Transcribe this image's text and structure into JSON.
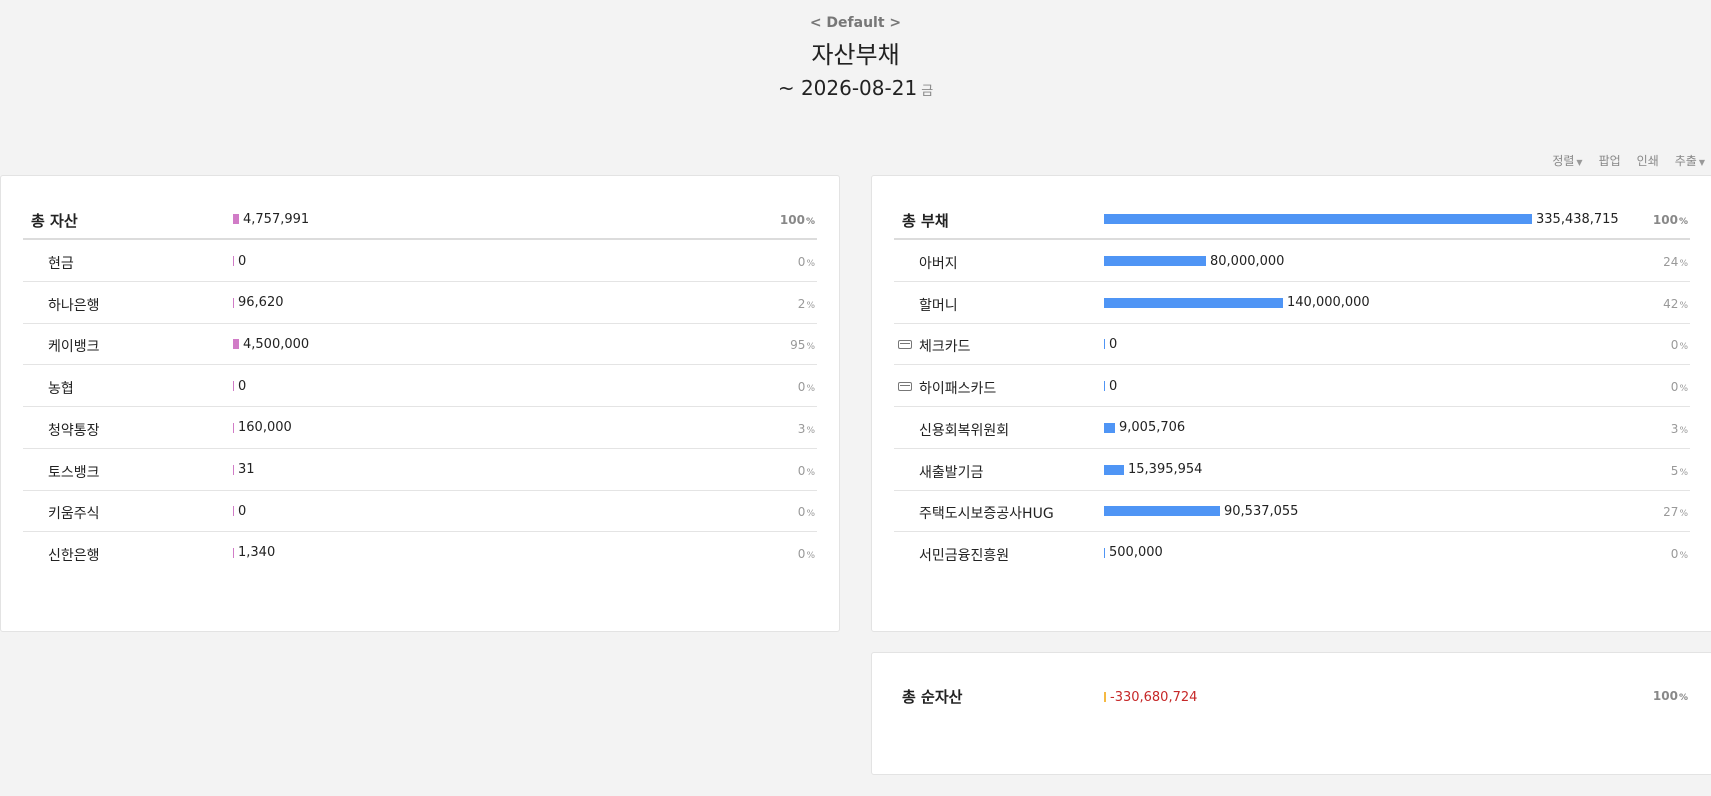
{
  "header": {
    "book": "< Default >",
    "title": "자산부채",
    "date": "~ 2026-08-21",
    "day_of_week": "금"
  },
  "toolbar": {
    "sort": "정렬",
    "popup": "팝업",
    "print": "인쇄",
    "export": "추출"
  },
  "colors": {
    "asset_bar": "#d17cc7",
    "liability_bar": "#4f95f5",
    "net_bar": "#f5b942",
    "negative_text": "#c62828"
  },
  "percent_sign": "%",
  "assets": {
    "total": {
      "label": "총 자산",
      "amount": "4,757,991",
      "percent": "100",
      "ratio": 0.0142
    },
    "items": [
      {
        "label": "현금",
        "amount": "0",
        "percent": "0",
        "ratio": 0
      },
      {
        "label": "하나은행",
        "amount": "96,620",
        "percent": "2",
        "ratio": 0.0003
      },
      {
        "label": "케이뱅크",
        "amount": "4,500,000",
        "percent": "95",
        "ratio": 0.0134
      },
      {
        "label": "농협",
        "amount": "0",
        "percent": "0",
        "ratio": 0
      },
      {
        "label": "청약통장",
        "amount": "160,000",
        "percent": "3",
        "ratio": 0.0005
      },
      {
        "label": "토스뱅크",
        "amount": "31",
        "percent": "0",
        "ratio": 0
      },
      {
        "label": "키움주식",
        "amount": "0",
        "percent": "0",
        "ratio": 0
      },
      {
        "label": "신한은행",
        "amount": "1,340",
        "percent": "0",
        "ratio": 0
      }
    ]
  },
  "liabilities": {
    "total": {
      "label": "총 부채",
      "amount": "335,438,715",
      "percent": "100",
      "ratio": 1.0
    },
    "items": [
      {
        "label": "아버지",
        "amount": "80,000,000",
        "percent": "24",
        "ratio": 0.2385,
        "icon": ""
      },
      {
        "label": "할머니",
        "amount": "140,000,000",
        "percent": "42",
        "ratio": 0.4174,
        "icon": ""
      },
      {
        "label": "체크카드",
        "amount": "0",
        "percent": "0",
        "ratio": 0,
        "icon": "card-icon"
      },
      {
        "label": "하이패스카드",
        "amount": "0",
        "percent": "0",
        "ratio": 0,
        "icon": "card-icon"
      },
      {
        "label": "신용회복위원회",
        "amount": "9,005,706",
        "percent": "3",
        "ratio": 0.0268,
        "icon": ""
      },
      {
        "label": "새출발기금",
        "amount": "15,395,954",
        "percent": "5",
        "ratio": 0.0459,
        "icon": ""
      },
      {
        "label": "주택도시보증공사HUG",
        "amount": "90,537,055",
        "percent": "27",
        "ratio": 0.2699,
        "icon": ""
      },
      {
        "label": "서민금융진흥원",
        "amount": "500,000",
        "percent": "0",
        "ratio": 0.0015,
        "icon": ""
      }
    ]
  },
  "net_assets": {
    "label": "총 순자산",
    "amount": "-330,680,724",
    "percent": "100",
    "ratio": 0.005
  }
}
